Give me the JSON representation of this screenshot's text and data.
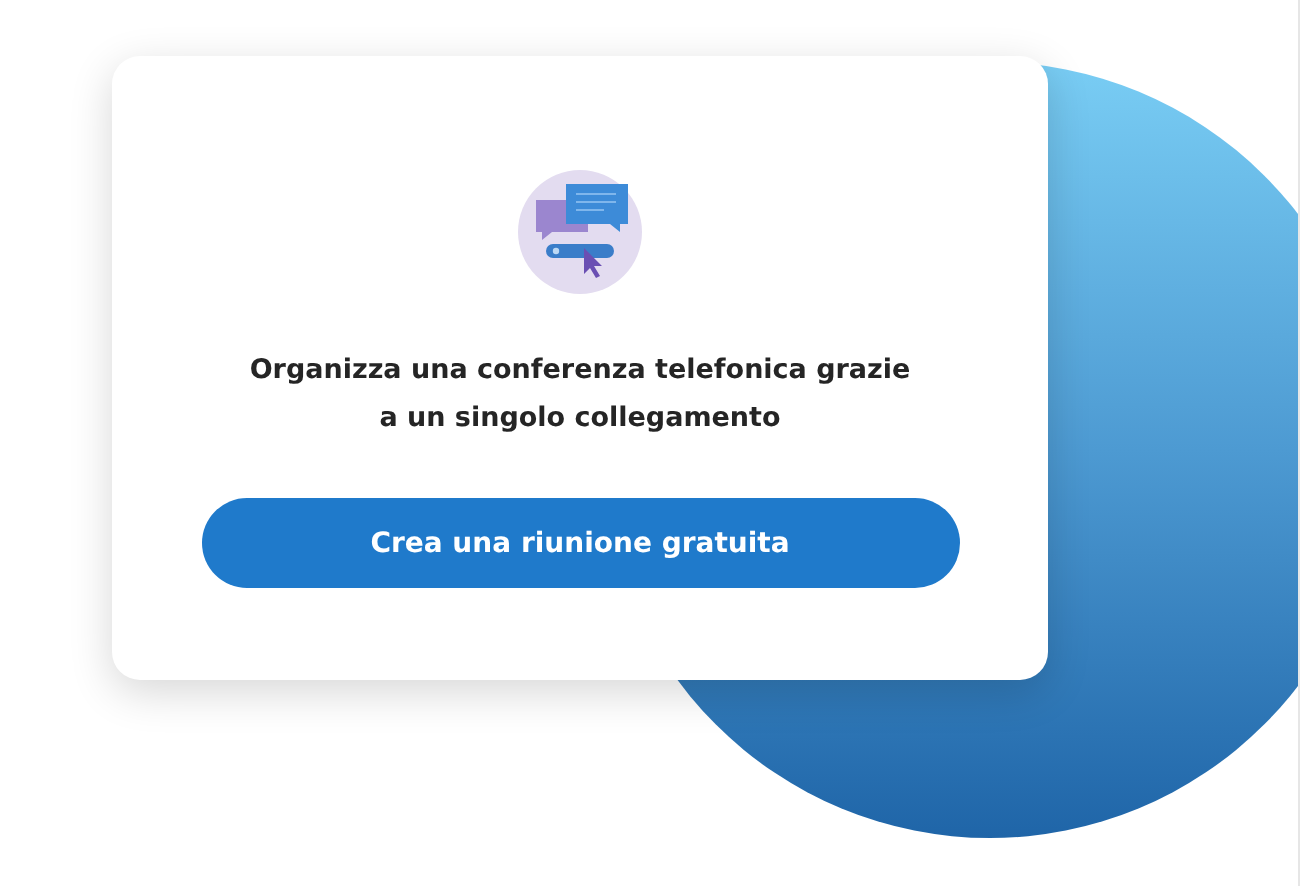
{
  "card": {
    "message": "Organizza una conferenza telefonica grazie a un singolo collegamento",
    "button": "Crea una riunione gratuita"
  }
}
